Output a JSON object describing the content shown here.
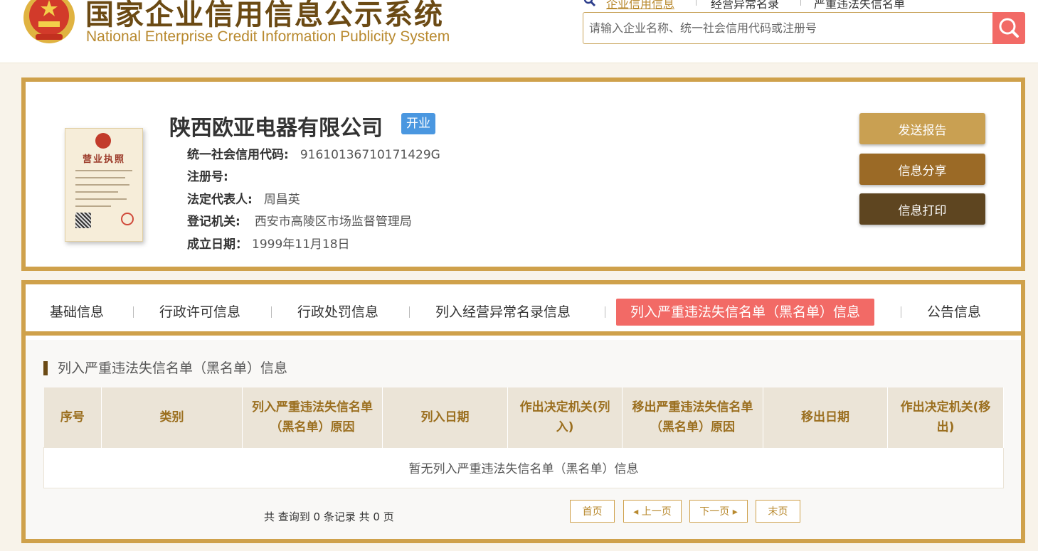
{
  "header": {
    "logo_cn": "国家企业信用信息公示系统",
    "logo_en": "National Enterprise Credit Information Publicity System",
    "nav_links": [
      "企业信用信息",
      "经营异常名录",
      "严重违法失信名单"
    ],
    "search_placeholder": "请输入企业名称、统一社会信用代码或注册号",
    "search_icon": "search-icon"
  },
  "company": {
    "name": "陕西欧亚电器有限公司",
    "status": "开业",
    "credit_code_label": "统一社会信用代码:",
    "credit_code": "916101367101714​29G",
    "reg_no_label": "注册号:",
    "reg_no": "",
    "legal_rep_label": "法定代表人:",
    "legal_rep": "周昌英",
    "authority_label": "登记机关:",
    "authority": "西安市高陵区市场监督管理局",
    "established_label": "成立日期：",
    "established": "1999年11月18日",
    "license_title": "营业执照"
  },
  "actions": {
    "send_report": "发送报告",
    "share": "信息分享",
    "print": "信息打印"
  },
  "tabs": [
    {
      "label": "基础信息"
    },
    {
      "label": "行政许可信息"
    },
    {
      "label": "行政处罚信息"
    },
    {
      "label": "列入经营异常名录信息"
    },
    {
      "label": "列入严重违法失信名单（黑名单）信息"
    },
    {
      "label": "公告信息"
    }
  ],
  "section": {
    "title": "列入严重违法失信名单（黑名单）信息",
    "columns": [
      "序号",
      "类别",
      "列入严重违法失信名单（黑名单）原因",
      "列入日期",
      "作出决定机关(列入)",
      "移出严重违法失信名单（黑名单）原因",
      "移出日期",
      "作出决定机关(移出)"
    ],
    "empty_message": "暂无列入严重违法失信名单（黑名单）信息"
  },
  "pagination": {
    "summary": "共 查询到 0 条记录 共 0 页",
    "first": "首页",
    "prev": "◂ 上一页",
    "next": "下一页 ▸",
    "last": "末页"
  },
  "colors": {
    "gold_border": "#cfa14b",
    "accent_red": "#f26a66",
    "badge_blue": "#4a97e0",
    "btn_report": "#c9a052",
    "btn_share": "#9b6a26",
    "btn_print": "#5e4520"
  }
}
